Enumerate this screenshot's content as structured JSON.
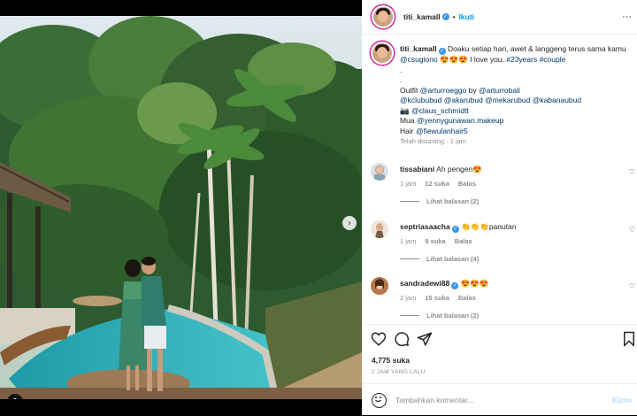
{
  "post": {
    "username": "titi_kamall",
    "follow_label": "Ikuti",
    "more_label": "···"
  },
  "caption": {
    "username": "titi_kamall",
    "text1": " Doaku setiap hari, awet & langgeng terus sama kamu ",
    "mention_partner": "@csugiono",
    "emojis1": " 😍😍😍 ",
    "text2": "I love you. ",
    "tag1": "#23years",
    "tag2": " #couple",
    "dot1": ".",
    "dot2": ".",
    "outfit_label": "Outfit ",
    "outfit_mention1": "@arturroeggo",
    "outfit_by": " by ",
    "outfit_mention2": "@arturrobali",
    "line_mentions1": "@kclububud @akarubud @mekarubud @kabanaubud",
    "camera": "📷 ",
    "line_mentions2": "@claus_schmidtt",
    "mua_label": "Mua ",
    "mua_mention": "@yennygunawan.makeup",
    "hair_label": "Hair ",
    "hair_mention": "@fiewulanhair5",
    "edited": "Telah disunting · 1 jam"
  },
  "comments": [
    {
      "user": "tissabiani",
      "text": " Ah pengen😍",
      "age": "1 jam",
      "likes": "12 suka",
      "reply": "Balas",
      "view_replies": "Lihat balasan (2)",
      "verified": false
    },
    {
      "user": "septriasaacha",
      "text": " 👏👏👏panutan",
      "age": "1 jam",
      "likes": "9 suka",
      "reply": "Balas",
      "view_replies": "Lihat balasan (4)",
      "verified": true
    },
    {
      "user": "sandradewi88",
      "text": " 😍😍😍",
      "age": "2 jam",
      "likes": "15 suka",
      "reply": "Balas",
      "view_replies": "Lihat balasan (2)",
      "verified": true
    }
  ],
  "stats": {
    "likes": "4,775 suka",
    "time_ago": "2 JAM YANG LALU"
  },
  "add_comment": {
    "placeholder": "Tambahkan komentar...",
    "send_label": "Kirim"
  },
  "icons": {
    "like": "heart-icon",
    "comment": "comment-icon",
    "share": "share-icon",
    "save": "bookmark-icon",
    "emoji": "emoji-icon",
    "next": "chevron-right-icon",
    "tags": "user-tag-icon"
  },
  "colors": {
    "accent": "#0095f6",
    "verified": "#3897f0",
    "pool": "#2fb3c0"
  }
}
